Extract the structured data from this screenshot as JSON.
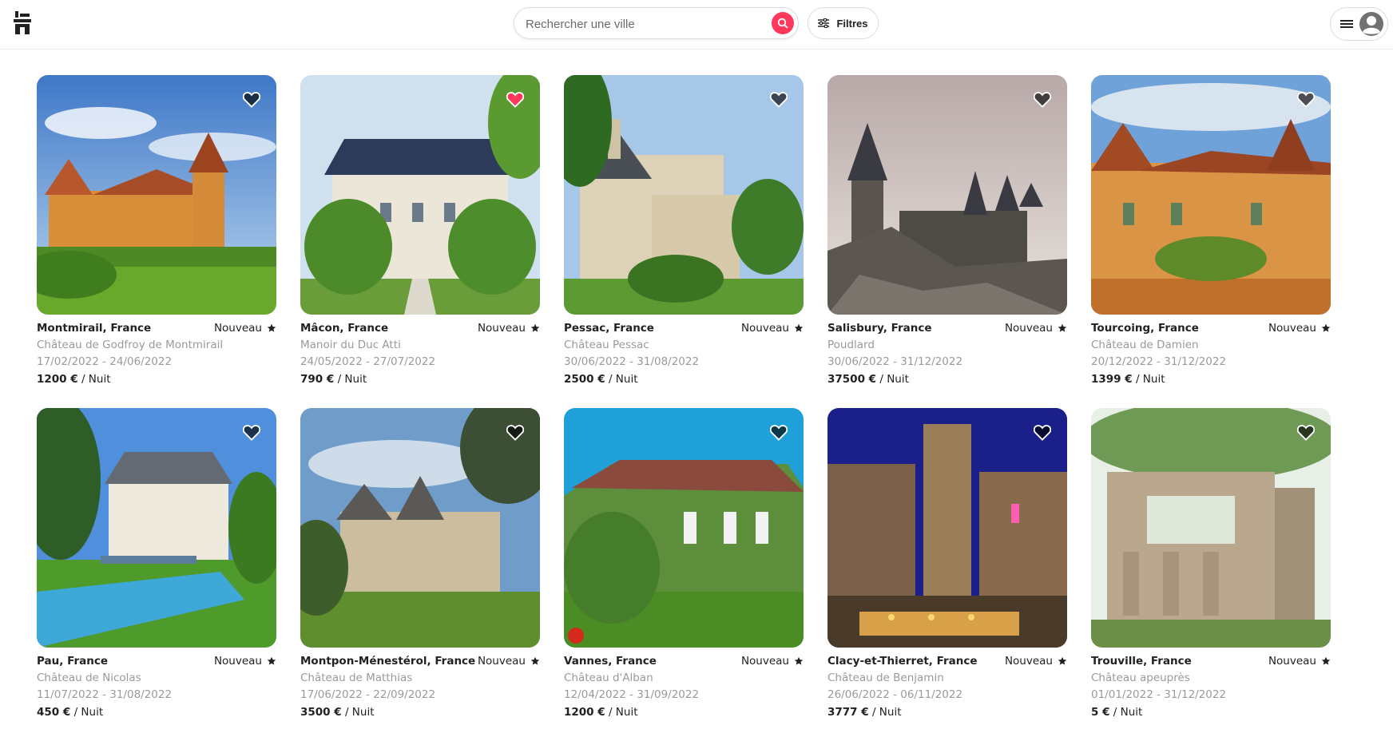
{
  "search": {
    "placeholder": "Rechercher une ville"
  },
  "filters": {
    "label": "Filtres"
  },
  "colors": {
    "accent": "#ff385c",
    "muted": "#9a9a9a"
  },
  "listings": [
    {
      "location": "Montmirail, France",
      "badge": "Nouveau",
      "name": "Château de Godfroy de Montmirail",
      "dates": "17/02/2022 - 24/06/2022",
      "price": "1200 €",
      "unit": "/ Nuit",
      "favorite": false
    },
    {
      "location": "Mâcon, France",
      "badge": "Nouveau",
      "name": "Manoir du Duc Atti",
      "dates": "24/05/2022 - 27/07/2022",
      "price": "790 €",
      "unit": "/ Nuit",
      "favorite": true
    },
    {
      "location": "Pessac, France",
      "badge": "Nouveau",
      "name": "Château Pessac",
      "dates": "30/06/2022 - 31/08/2022",
      "price": "2500 €",
      "unit": "/ Nuit",
      "favorite": false
    },
    {
      "location": "Salisbury, France",
      "badge": "Nouveau",
      "name": "Poudlard",
      "dates": "30/06/2022 - 31/12/2022",
      "price": "37500 €",
      "unit": "/ Nuit",
      "favorite": false
    },
    {
      "location": "Tourcoing, France",
      "badge": "Nouveau",
      "name": "Château de Damien",
      "dates": "20/12/2022 - 31/12/2022",
      "price": "1399 €",
      "unit": "/ Nuit",
      "favorite": false
    },
    {
      "location": "Pau, France",
      "badge": "Nouveau",
      "name": "Château de Nicolas",
      "dates": "11/07/2022 - 31/08/2022",
      "price": "450 €",
      "unit": "/ Nuit",
      "favorite": false
    },
    {
      "location": "Montpon-Ménestérol, France",
      "badge": "Nouveau",
      "name": "Château de Matthias",
      "dates": "17/06/2022 - 22/09/2022",
      "price": "3500 €",
      "unit": "/ Nuit",
      "favorite": false
    },
    {
      "location": "Vannes, France",
      "badge": "Nouveau",
      "name": "Château d'Alban",
      "dates": "12/04/2022 - 31/09/2022",
      "price": "1200 €",
      "unit": "/ Nuit",
      "favorite": false
    },
    {
      "location": "Clacy-et-Thierret, France",
      "badge": "Nouveau",
      "name": "Château de Benjamin",
      "dates": "26/06/2022 - 06/11/2022",
      "price": "3777 €",
      "unit": "/ Nuit",
      "favorite": false
    },
    {
      "location": "Trouville, France",
      "badge": "Nouveau",
      "name": "Château apeuprès",
      "dates": "01/01/2022 - 31/12/2022",
      "price": "5 €",
      "unit": "/ Nuit",
      "favorite": false
    }
  ]
}
